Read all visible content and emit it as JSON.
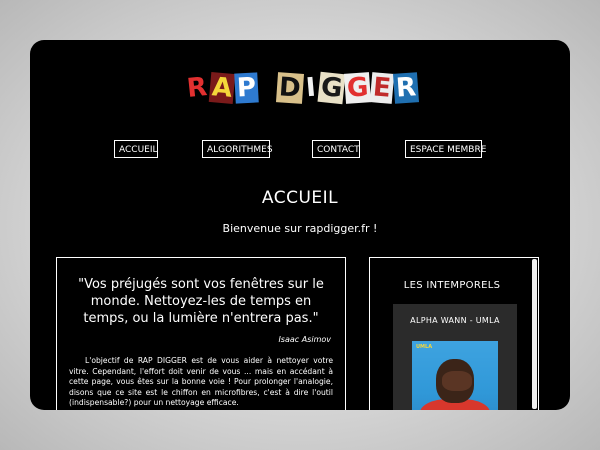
{
  "logo": {
    "word1": [
      "R",
      "A",
      "P"
    ],
    "word2": [
      "D",
      "I",
      "G",
      "G",
      "E",
      "R"
    ]
  },
  "nav": {
    "items": [
      "ACCUEIL",
      "ALGORITHMES",
      "CONTACT",
      "ESPACE MEMBRE"
    ]
  },
  "main": {
    "title": "ACCUEIL",
    "welcome": "Bienvenue sur rapdigger.fr !"
  },
  "quote": {
    "text": "\"Vos préjugés sont vos fenêtres sur le monde. Nettoyez-les de temps en temps, ou la lumière n'entrera pas.\"",
    "author": "Isaac Asimov",
    "body": "L'objectif de RAP DIGGER est de vous aider à nettoyer votre vitre. Cependant, l'effort doit venir de vous ... mais en accédant à cette page, vous êtes sur la bonne voie ! Pour prolonger l'analogie, disons que ce site est le chiffon en microfibres, c'est à dire l'outil (indispensable?) pour un nettoyage efficace."
  },
  "sidebar": {
    "title": "LES INTEMPORELS",
    "album": {
      "title": "ALPHA WANN - UMLA",
      "cover_label": "UMLA"
    }
  },
  "colors": {
    "frame_bg": "#000000",
    "text": "#ffffff",
    "album_card_bg": "#2b2b2b",
    "cover_blue": "#3098d8",
    "cover_red": "#d8372c"
  }
}
